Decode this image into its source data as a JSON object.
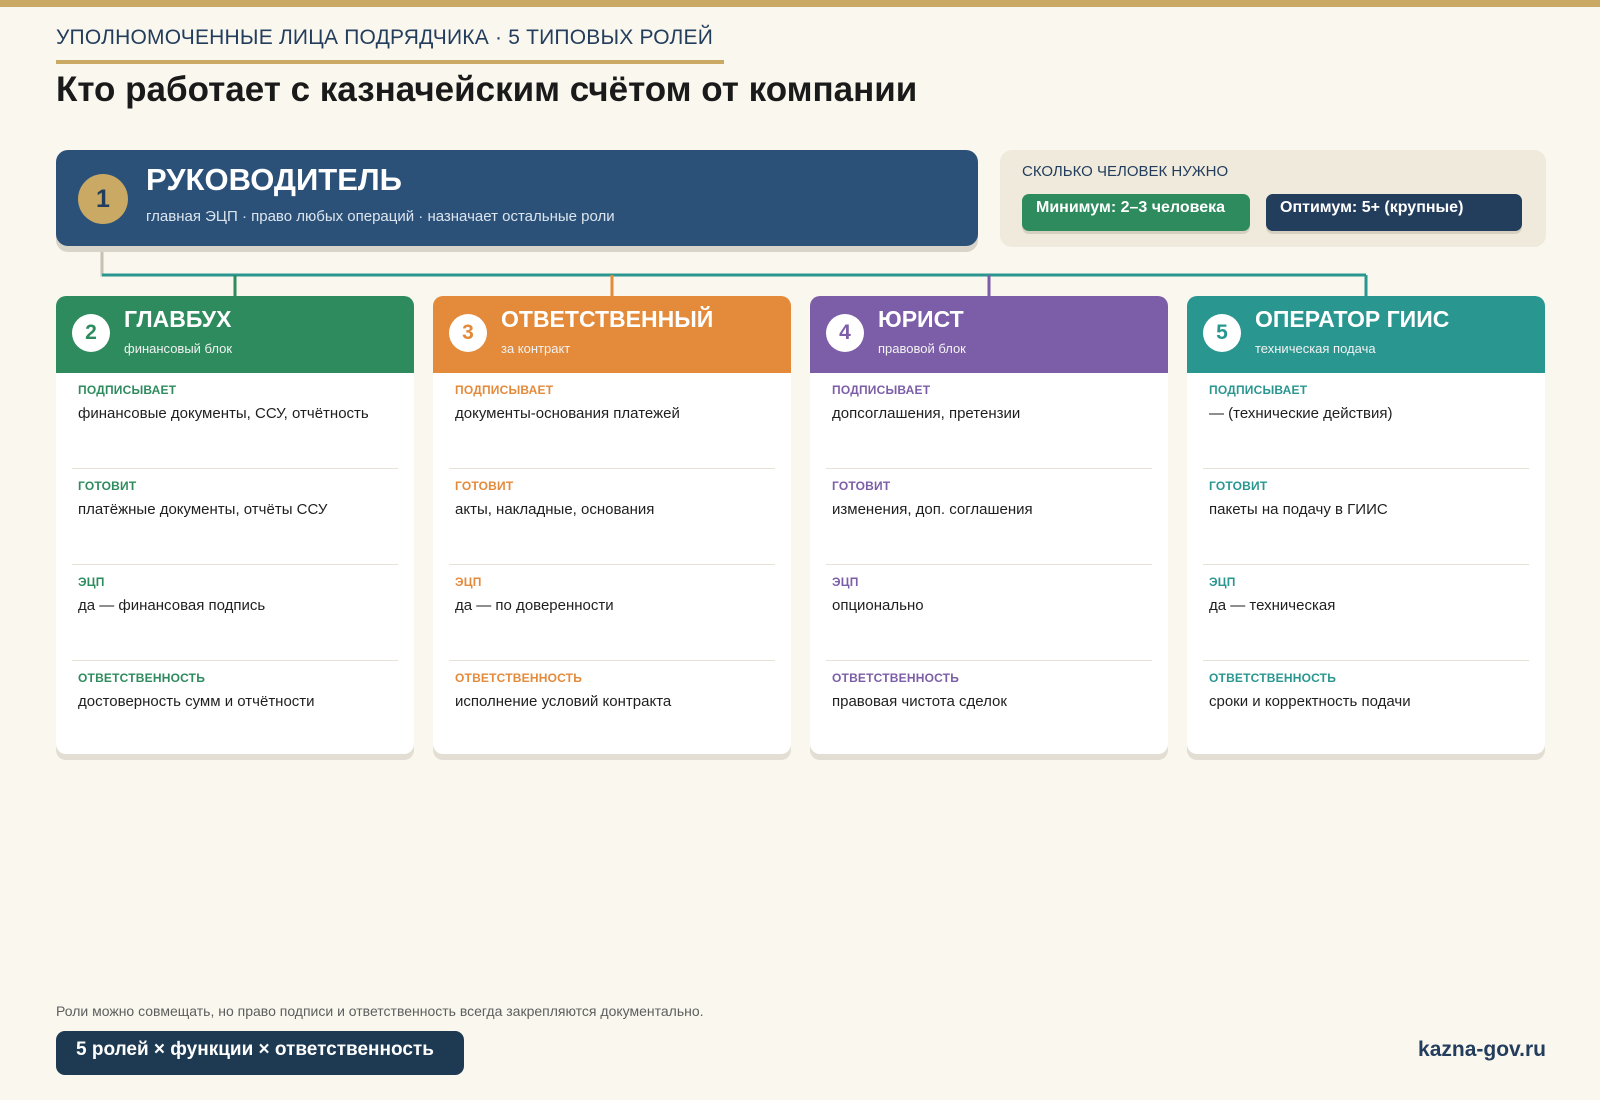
{
  "header": {
    "eyebrow": "УПОЛНОМОЧЕННЫЕ ЛИЦА ПОДРЯДЧИКА · 5 ТИПОВЫХ РОЛЕЙ",
    "title": "Кто работает с казначейским счётом от компании"
  },
  "leader": {
    "number": "1",
    "title": "РУКОВОДИТЕЛЬ",
    "subtitle": "главная ЭЦП · право любых операций · назначает остальные роли"
  },
  "staffing": {
    "title": "СКОЛЬКО ЧЕЛОВЕК НУЖНО",
    "minimum": "Минимум: 2–3 человека",
    "optimum": "Оптимум: 5+ (крупные)"
  },
  "row_labels": {
    "signs": "ПОДПИСЫВАЕТ",
    "prepares": "ГОТОВИТ",
    "eds": "ЭЦП",
    "responsibility": "ОТВЕТСТВЕННОСТЬ"
  },
  "roles": [
    {
      "number": "2",
      "title": "ГЛАВБУХ",
      "subtitle": "финансовый блок",
      "color": "#2e8b5e",
      "signs": "финансовые документы, ССУ, отчётность",
      "prepares": "платёжные документы, отчёты ССУ",
      "eds": "да — финансовая подпись",
      "responsibility": "достоверность сумм и отчётности"
    },
    {
      "number": "3",
      "title": "ОТВЕТСТВЕННЫЙ",
      "subtitle": "за контракт",
      "color": "#e38a3b",
      "signs": "документы-основания платежей",
      "prepares": "акты, накладные, основания",
      "eds": "да — по доверенности",
      "responsibility": "исполнение условий контракта"
    },
    {
      "number": "4",
      "title": "ЮРИСТ",
      "subtitle": "правовой блок",
      "color": "#7b5ea7",
      "signs": "допсоглашения, претензии",
      "prepares": "изменения, доп. соглашения",
      "eds": "опционально",
      "responsibility": "правовая чистота сделок"
    },
    {
      "number": "5",
      "title": "ОПЕРАТОР ГИИС",
      "subtitle": "техническая подача",
      "color": "#2a9690",
      "signs": "— (технические действия)",
      "prepares": "пакеты на подачу в ГИИС",
      "eds": "да — техническая",
      "responsibility": "сроки и корректность подачи"
    }
  ],
  "footer": {
    "note": "Роли можно совмещать, но право подписи и ответственность всегда закрепляются документально.",
    "pill": "5 ролей × функции × ответственность",
    "brand": "kazna-gov.ru"
  },
  "colors": {
    "navy": "#2b5178",
    "gold": "#c9a964",
    "background": "#faf7ee",
    "connector": "#2a9690"
  }
}
